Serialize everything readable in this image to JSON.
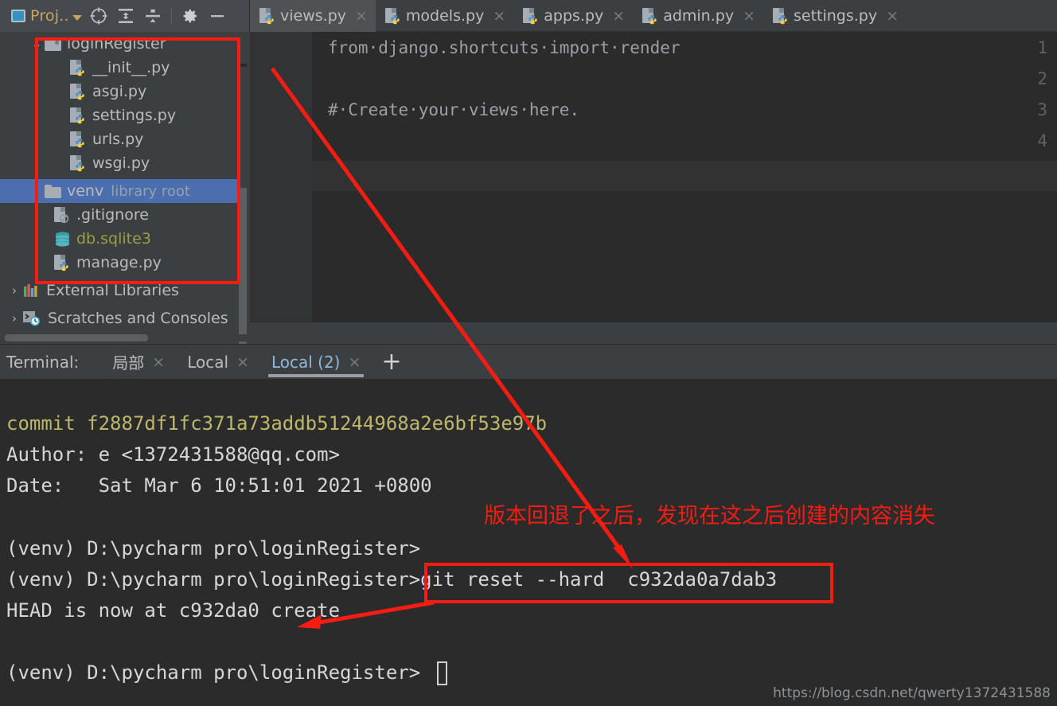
{
  "toolbar": {
    "project_label": "Proj..",
    "icons": [
      {
        "name": "locate-target-icon",
        "glyph": "target"
      },
      {
        "name": "expand-all-icon",
        "glyph": "expand"
      },
      {
        "name": "collapse-all-icon",
        "glyph": "collapse"
      },
      {
        "name": "settings-gear-icon",
        "glyph": "gear"
      },
      {
        "name": "minimize-icon",
        "glyph": "minus"
      }
    ]
  },
  "editor_tabs": [
    {
      "label": "views.py",
      "active": true,
      "icon": "python-file-icon",
      "close": "×"
    },
    {
      "label": "models.py",
      "active": false,
      "icon": "python-file-icon",
      "close": "×"
    },
    {
      "label": "apps.py",
      "active": false,
      "icon": "python-file-icon",
      "close": "×"
    },
    {
      "label": "admin.py",
      "active": false,
      "icon": "python-file-icon",
      "close": "×"
    },
    {
      "label": "settings.py",
      "active": false,
      "icon": "python-file-icon",
      "close": "×"
    }
  ],
  "project_tree": [
    {
      "label": "loginRegister",
      "type": "folder",
      "arrow": "⌄",
      "indent": 36,
      "selected": false,
      "suffix": ""
    },
    {
      "label": "__init__.py",
      "type": "python",
      "arrow": "",
      "indent": 88,
      "selected": false,
      "suffix": ""
    },
    {
      "label": "asgi.py",
      "type": "python",
      "arrow": "",
      "indent": 88,
      "selected": false,
      "suffix": ""
    },
    {
      "label": "settings.py",
      "type": "python",
      "arrow": "",
      "indent": 88,
      "selected": false,
      "suffix": ""
    },
    {
      "label": "urls.py",
      "type": "python",
      "arrow": "",
      "indent": 88,
      "selected": false,
      "suffix": ""
    },
    {
      "label": "wsgi.py",
      "type": "python",
      "arrow": "",
      "indent": 88,
      "selected": false,
      "suffix": ""
    },
    {
      "label": "venv",
      "type": "folder-plain",
      "arrow": "›",
      "indent": 36,
      "selected": true,
      "suffix": "library root"
    },
    {
      "label": ".gitignore",
      "type": "ignored-file",
      "arrow": "",
      "indent": 68,
      "selected": false,
      "suffix": ""
    },
    {
      "label": "db.sqlite3",
      "type": "database",
      "arrow": "",
      "indent": 68,
      "selected": false,
      "suffix": ""
    },
    {
      "label": "manage.py",
      "type": "python",
      "arrow": "",
      "indent": 68,
      "selected": false,
      "suffix": ""
    },
    {
      "label": "External Libraries",
      "type": "libraries",
      "arrow": "›",
      "indent": 12,
      "selected": false,
      "suffix": ""
    },
    {
      "label": "Scratches and Consoles",
      "type": "scratches",
      "arrow": "›",
      "indent": 12,
      "selected": false,
      "suffix": ""
    }
  ],
  "code": {
    "line_numbers": [
      "1",
      "2",
      "3",
      "4"
    ],
    "lines": [
      "from·django.shortcuts·import·render",
      "",
      "#·Create·your·views·here.",
      ""
    ]
  },
  "terminal_panel": {
    "title": "Terminal:",
    "tabs": [
      {
        "label": "局部",
        "active": false,
        "close": "×"
      },
      {
        "label": "Local",
        "active": false,
        "close": "×"
      },
      {
        "label": "Local (2)",
        "active": true,
        "close": "×"
      }
    ],
    "add_tab": "+"
  },
  "terminal_output": [
    {
      "text": "commit f2887df1fc371a73addb51244968a2e6bf53e97b",
      "color": "yellow"
    },
    {
      "text": "Author: e <1372431588@qq.com>",
      "color": "normal"
    },
    {
      "text": "Date:   Sat Mar 6 10:51:01 2021 +0800",
      "color": "normal"
    },
    {
      "text": "(venv) D:\\pycharm pro\\loginRegister>",
      "color": "normal"
    },
    {
      "text": "(venv) D:\\pycharm pro\\loginRegister>git reset --hard  c932da0a7dab3",
      "color": "normal"
    },
    {
      "text": "HEAD is now at c932da0 create",
      "color": "normal"
    },
    {
      "text": "(venv) D:\\pycharm pro\\loginRegister>",
      "color": "normal"
    }
  ],
  "annotations": {
    "note_text": "版本回退了之后，发现在这之后创建的内容消失",
    "highlight_color": "#f51c12"
  },
  "watermark": "https://blog.csdn.net/qwerty1372431588"
}
